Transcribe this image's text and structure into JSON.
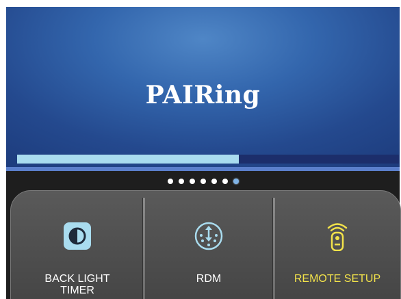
{
  "screen": {
    "title": "PAIRing",
    "progress": 0.58
  },
  "pager": {
    "count": 7,
    "active_index": 6
  },
  "menu": {
    "items": [
      {
        "label_line1": "BACK LIGHT",
        "label_line2": "TIMER",
        "icon": "backlight-contrast-icon",
        "selected": false
      },
      {
        "label_line1": "RDM",
        "label_line2": "",
        "icon": "rdm-connector-icon",
        "selected": false
      },
      {
        "label_line1": "REMOTE SETUP",
        "label_line2": "",
        "icon": "remote-control-icon",
        "selected": true
      }
    ]
  },
  "colors": {
    "screen_bg": "#3366ad",
    "progress_fill": "#a9dcef",
    "progress_track": "#1c2e6b",
    "highlight": "#f2e24a",
    "icon_accent": "#9fd3ea"
  }
}
